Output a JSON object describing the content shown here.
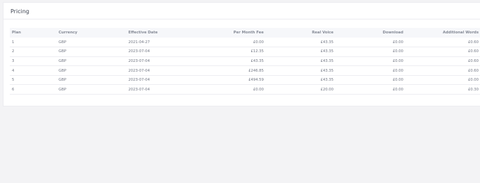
{
  "pricing": {
    "title": "Pricing",
    "columns": [
      "Plan",
      "Currency",
      "Effective Date",
      "Per Month Fee",
      "Real Voice",
      "Download",
      "Additional Words"
    ],
    "rows": [
      [
        "1",
        "GBP",
        "2021-04-27",
        "£0.00",
        "£43.35",
        "£0.00",
        "£0.60"
      ],
      [
        "2",
        "GBP",
        "2023-07-04",
        "£12.35",
        "£43.35",
        "£0.00",
        "£0.60"
      ],
      [
        "3",
        "GBP",
        "2023-07-04",
        "£43.35",
        "£43.35",
        "£0.00",
        "£0.60"
      ],
      [
        "4",
        "GBP",
        "2023-07-04",
        "£246.85",
        "£43.35",
        "£0.00",
        "£0.60"
      ],
      [
        "5",
        "GBP",
        "2023-07-04",
        "£494.59",
        "£43.35",
        "£0.00",
        "£0.00"
      ],
      [
        "6",
        "GBP",
        "2023-07-04",
        "£0.00",
        "£20.00",
        "£0.00",
        "£0.30"
      ]
    ]
  }
}
